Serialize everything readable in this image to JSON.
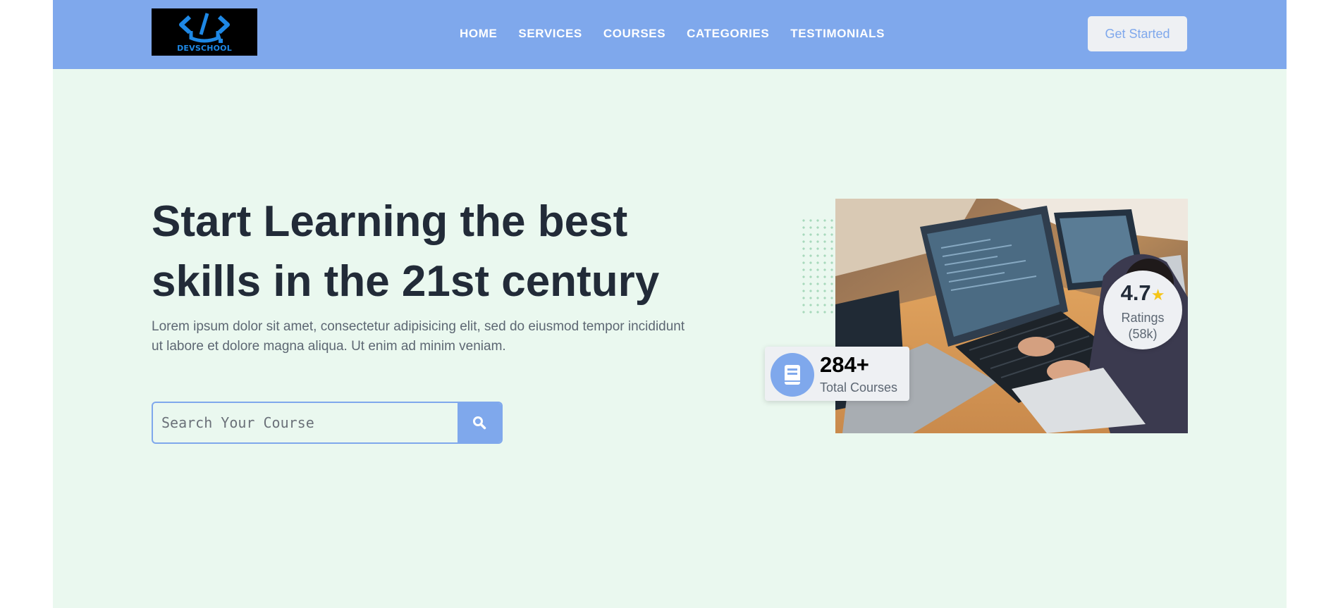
{
  "logo": {
    "text": "DEVSCHOOL",
    "icon": "code-graduation-cap-icon"
  },
  "nav": {
    "items": [
      {
        "label": "HOME"
      },
      {
        "label": "SERVICES"
      },
      {
        "label": "COURSES"
      },
      {
        "label": "CATEGORIES"
      },
      {
        "label": "TESTIMONIALS"
      }
    ],
    "cta_label": "Get Started"
  },
  "hero": {
    "title": "Start Learning the best skills in the 21st century",
    "description": "Lorem ipsum dolor sit amet, consectetur adipisicing elit, sed do eiusmod tempor incididunt ut labore et dolore magna aliqua. Ut enim ad minim veniam.",
    "search": {
      "placeholder": "Search Your Course",
      "value": ""
    }
  },
  "stats": {
    "rating_value": "4.7",
    "rating_label_line1": "Ratings",
    "rating_label_line2": "(58k)",
    "courses_count": "284+",
    "courses_label": "Total Courses"
  },
  "colors": {
    "primary": "#7fa8ec",
    "background": "#eaf8ef",
    "heading": "#222b38",
    "muted": "#5d6773",
    "star": "#f5c518"
  },
  "icons": [
    "search-icon",
    "star-icon",
    "book-icon",
    "code-graduation-cap-icon"
  ]
}
